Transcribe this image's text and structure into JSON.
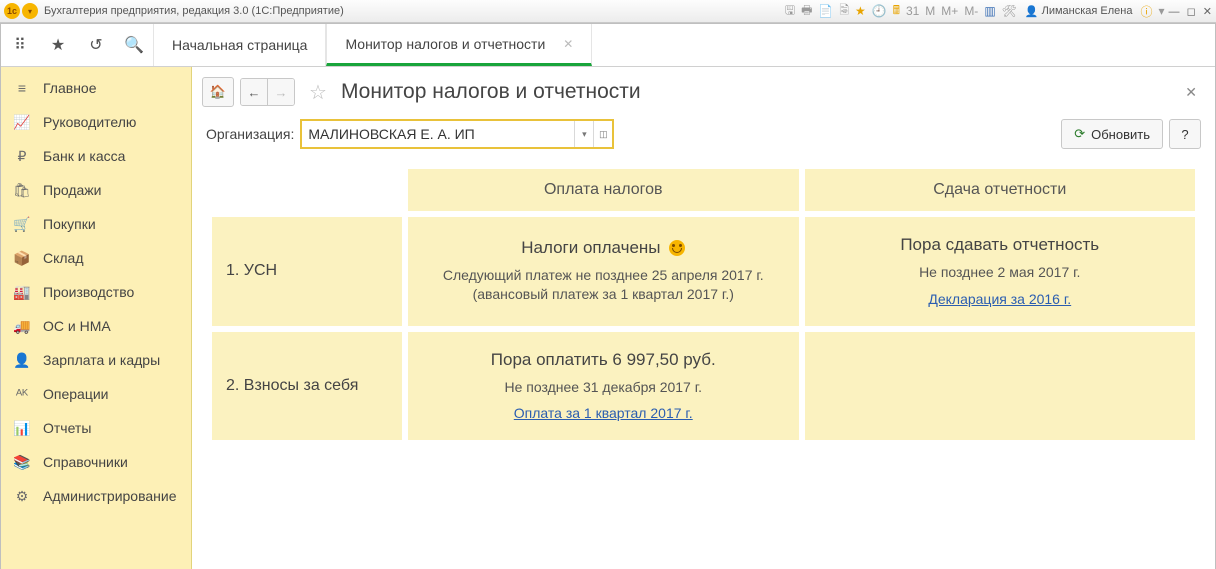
{
  "titlebar": {
    "app_title": "Бухгалтерия предприятия, редакция 3.0  (1С:Предприятие)",
    "user_name": "Лиманская Елена",
    "m_labels": [
      "M",
      "M+",
      "M-"
    ]
  },
  "tabs": {
    "start": "Начальная страница",
    "active": "Монитор налогов и отчетности"
  },
  "sidebar": {
    "items": [
      {
        "icon": "≡",
        "label": "Главное"
      },
      {
        "icon": "📈",
        "label": "Руководителю"
      },
      {
        "icon": "₽",
        "label": "Банк и касса"
      },
      {
        "icon": "🛍",
        "label": "Продажи"
      },
      {
        "icon": "🛒",
        "label": "Покупки"
      },
      {
        "icon": "📦",
        "label": "Склад"
      },
      {
        "icon": "🏭",
        "label": "Производство"
      },
      {
        "icon": "🚚",
        "label": "ОС и НМА"
      },
      {
        "icon": "👤",
        "label": "Зарплата и кадры"
      },
      {
        "icon": "ᴬᴷ",
        "label": "Операции"
      },
      {
        "icon": "📊",
        "label": "Отчеты"
      },
      {
        "icon": "📚",
        "label": "Справочники"
      },
      {
        "icon": "⚙",
        "label": "Администрирование"
      }
    ]
  },
  "page": {
    "title": "Монитор налогов и отчетности",
    "org_label": "Организация:",
    "org_value": "МАЛИНОВСКАЯ Е. А. ИП",
    "refresh": "Обновить",
    "help": "?"
  },
  "grid": {
    "col_pay": "Оплата налогов",
    "col_rep": "Сдача отчетности",
    "rows": [
      {
        "label": "1. УСН",
        "pay": {
          "title": "Налоги оплачены",
          "line1": "Следующий платеж не позднее 25 апреля 2017 г.",
          "line2": "(авансовый платеж за 1 квартал 2017 г.)"
        },
        "rep": {
          "title": "Пора сдавать отчетность",
          "line1": "Не позднее 2 мая 2017 г.",
          "link": "Декларация за 2016 г."
        }
      },
      {
        "label": "2. Взносы за себя",
        "pay": {
          "title": "Пора оплатить 6 997,50 руб.",
          "line1": "Не позднее 31 декабря 2017 г.",
          "link": "Оплата за 1 квартал 2017 г."
        }
      }
    ]
  }
}
